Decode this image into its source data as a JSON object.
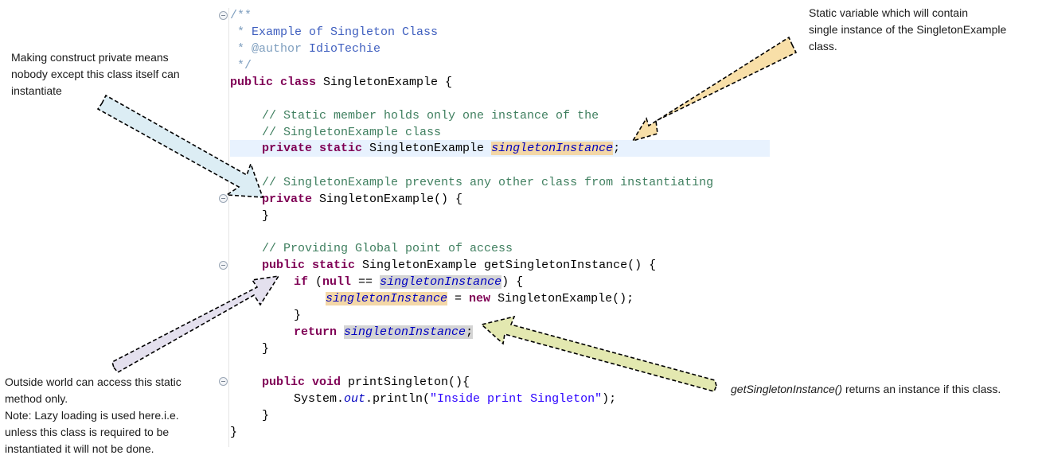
{
  "annotations": {
    "constructor_note": [
      "Making construct private means",
      "nobody except this class itself can",
      "instantiate"
    ],
    "static_var_note": [
      "Static variable which will contain",
      "single instance of the SingletonExample",
      "class."
    ],
    "accessor_note": [
      "Outside world can access this static",
      "method only.",
      "Note: Lazy loading is used here.i.e.",
      "unless this class is required to be",
      "instantiated it will not be done."
    ],
    "return_note": {
      "method": "getSingletonInstance()",
      "text": " returns an instance if this class."
    }
  },
  "code": {
    "javadoc_open": "/**",
    "javadoc_line1_star": " * ",
    "javadoc_line1": "Example of Singleton Class",
    "javadoc_line2_star": " * ",
    "javadoc_tag": "@author",
    "javadoc_author": " IdioTechie",
    "javadoc_close": " */",
    "class_kw": "public class",
    "class_name": " SingletonExample {",
    "comment1": "// Static member holds only one instance of the",
    "comment2": "// SingletonExample class",
    "field_kw": "private static",
    "field_type": " SingletonExample ",
    "field_name": "singletonInstance",
    "semicolon": ";",
    "comment3": "// SingletonExample prevents any other class from instantiating",
    "ctor_kw": "private",
    "ctor_sig": " SingletonExample() {",
    "close_brace": "}",
    "comment4": "// Providing Global point of access",
    "getter_kw": "public static",
    "getter_sig": " SingletonExample getSingletonInstance() {",
    "if_kw": "if",
    "if_open": " (",
    "null_kw": "null",
    "if_eq": " == ",
    "if_close": ") {",
    "assign_rest": " = ",
    "new_kw": "new",
    "new_rest": " SingletonExample();",
    "return_kw": "return",
    "print_kw": "public void",
    "print_sig": " printSingleton(){",
    "sysout_a": "System.",
    "sysout_out": "out",
    "sysout_b": ".println(",
    "sysout_str": "\"Inside print Singleton\"",
    "sysout_c": ");"
  },
  "colors": {
    "arrow_constructor": "#dcedf4",
    "arrow_static_var": "#f8dfa8",
    "arrow_accessor": "#e4e0ee",
    "arrow_return": "#e3e8b0"
  }
}
